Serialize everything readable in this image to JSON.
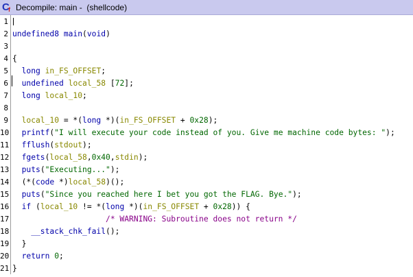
{
  "window": {
    "title": "Decompile: main -  (shellcode)"
  },
  "code_lines": [
    {
      "n": "1",
      "segs": []
    },
    {
      "n": "2",
      "segs": [
        {
          "t": "undefined8",
          "c": "blue"
        },
        {
          "t": " ",
          "c": "pl"
        },
        {
          "t": "main",
          "c": "blue"
        },
        {
          "t": "(",
          "c": "pl"
        },
        {
          "t": "void",
          "c": "blue"
        },
        {
          "t": ")",
          "c": "pl"
        }
      ]
    },
    {
      "n": "3",
      "segs": []
    },
    {
      "n": "4",
      "segs": [
        {
          "t": "{",
          "c": "pl"
        }
      ]
    },
    {
      "n": "5",
      "segs": [
        {
          "t": "  long",
          "c": "blue"
        },
        {
          "t": " ",
          "c": "pl"
        },
        {
          "t": "in_FS_OFFSET",
          "c": "var"
        },
        {
          "t": ";",
          "c": "pl"
        }
      ]
    },
    {
      "n": "6",
      "segs": [
        {
          "t": "  undefined",
          "c": "blue"
        },
        {
          "t": " ",
          "c": "pl"
        },
        {
          "t": "local_58",
          "c": "var"
        },
        {
          "t": " [",
          "c": "pl"
        },
        {
          "t": "72",
          "c": "num"
        },
        {
          "t": "];",
          "c": "pl"
        }
      ]
    },
    {
      "n": "7",
      "segs": [
        {
          "t": "  long",
          "c": "blue"
        },
        {
          "t": " ",
          "c": "pl"
        },
        {
          "t": "local_10",
          "c": "var"
        },
        {
          "t": ";",
          "c": "pl"
        }
      ]
    },
    {
      "n": "8",
      "segs": []
    },
    {
      "n": "9",
      "segs": [
        {
          "t": "  local_10",
          "c": "var"
        },
        {
          "t": " = *(",
          "c": "pl"
        },
        {
          "t": "long",
          "c": "blue"
        },
        {
          "t": " *)(",
          "c": "pl"
        },
        {
          "t": "in_FS_OFFSET",
          "c": "var"
        },
        {
          "t": " + ",
          "c": "pl"
        },
        {
          "t": "0x28",
          "c": "num"
        },
        {
          "t": ");",
          "c": "pl"
        }
      ]
    },
    {
      "n": "10",
      "segs": [
        {
          "t": "  printf",
          "c": "blue"
        },
        {
          "t": "(",
          "c": "pl"
        },
        {
          "t": "\"I will execute your code instead of you. Give me machine code bytes: \"",
          "c": "str"
        },
        {
          "t": ");",
          "c": "pl"
        }
      ]
    },
    {
      "n": "11",
      "segs": [
        {
          "t": "  fflush",
          "c": "blue"
        },
        {
          "t": "(",
          "c": "pl"
        },
        {
          "t": "stdout",
          "c": "var"
        },
        {
          "t": ");",
          "c": "pl"
        }
      ]
    },
    {
      "n": "12",
      "segs": [
        {
          "t": "  fgets",
          "c": "blue"
        },
        {
          "t": "(",
          "c": "pl"
        },
        {
          "t": "local_58",
          "c": "var"
        },
        {
          "t": ",",
          "c": "pl"
        },
        {
          "t": "0x40",
          "c": "num"
        },
        {
          "t": ",",
          "c": "pl"
        },
        {
          "t": "stdin",
          "c": "var"
        },
        {
          "t": ");",
          "c": "pl"
        }
      ]
    },
    {
      "n": "13",
      "segs": [
        {
          "t": "  puts",
          "c": "blue"
        },
        {
          "t": "(",
          "c": "pl"
        },
        {
          "t": "\"Executing...\"",
          "c": "str"
        },
        {
          "t": ");",
          "c": "pl"
        }
      ]
    },
    {
      "n": "14",
      "segs": [
        {
          "t": "  (*(",
          "c": "pl"
        },
        {
          "t": "code",
          "c": "blue"
        },
        {
          "t": " *)",
          "c": "pl"
        },
        {
          "t": "local_58",
          "c": "var"
        },
        {
          "t": ")();",
          "c": "pl"
        }
      ]
    },
    {
      "n": "15",
      "segs": [
        {
          "t": "  puts",
          "c": "blue"
        },
        {
          "t": "(",
          "c": "pl"
        },
        {
          "t": "\"Since you reached here I bet you got the FLAG. Bye.\"",
          "c": "str"
        },
        {
          "t": ");",
          "c": "pl"
        }
      ]
    },
    {
      "n": "16",
      "segs": [
        {
          "t": "  if",
          "c": "blue"
        },
        {
          "t": " (",
          "c": "pl"
        },
        {
          "t": "local_10",
          "c": "var"
        },
        {
          "t": " != *(",
          "c": "pl"
        },
        {
          "t": "long",
          "c": "blue"
        },
        {
          "t": " *)(",
          "c": "pl"
        },
        {
          "t": "in_FS_OFFSET",
          "c": "var"
        },
        {
          "t": " + ",
          "c": "pl"
        },
        {
          "t": "0x28",
          "c": "num"
        },
        {
          "t": ")) {",
          "c": "pl"
        }
      ]
    },
    {
      "n": "17",
      "segs": [
        {
          "t": "                    ",
          "c": "pl"
        },
        {
          "t": "/* WARNING: Subroutine does not return */",
          "c": "cmt"
        }
      ]
    },
    {
      "n": "18",
      "segs": [
        {
          "t": "    __stack_chk_fail",
          "c": "blue"
        },
        {
          "t": "();",
          "c": "pl"
        }
      ]
    },
    {
      "n": "19",
      "segs": [
        {
          "t": "  }",
          "c": "pl"
        }
      ]
    },
    {
      "n": "20",
      "segs": [
        {
          "t": "  return",
          "c": "blue"
        },
        {
          "t": " ",
          "c": "pl"
        },
        {
          "t": "0",
          "c": "num"
        },
        {
          "t": ";",
          "c": "pl"
        }
      ]
    },
    {
      "n": "21",
      "segs": [
        {
          "t": "}",
          "c": "pl"
        }
      ]
    }
  ],
  "colors": {
    "titlebar": "#c9c9ee",
    "keyword": "#0000aa",
    "variable": "#888800",
    "string": "#006600",
    "comment": "#880088"
  }
}
